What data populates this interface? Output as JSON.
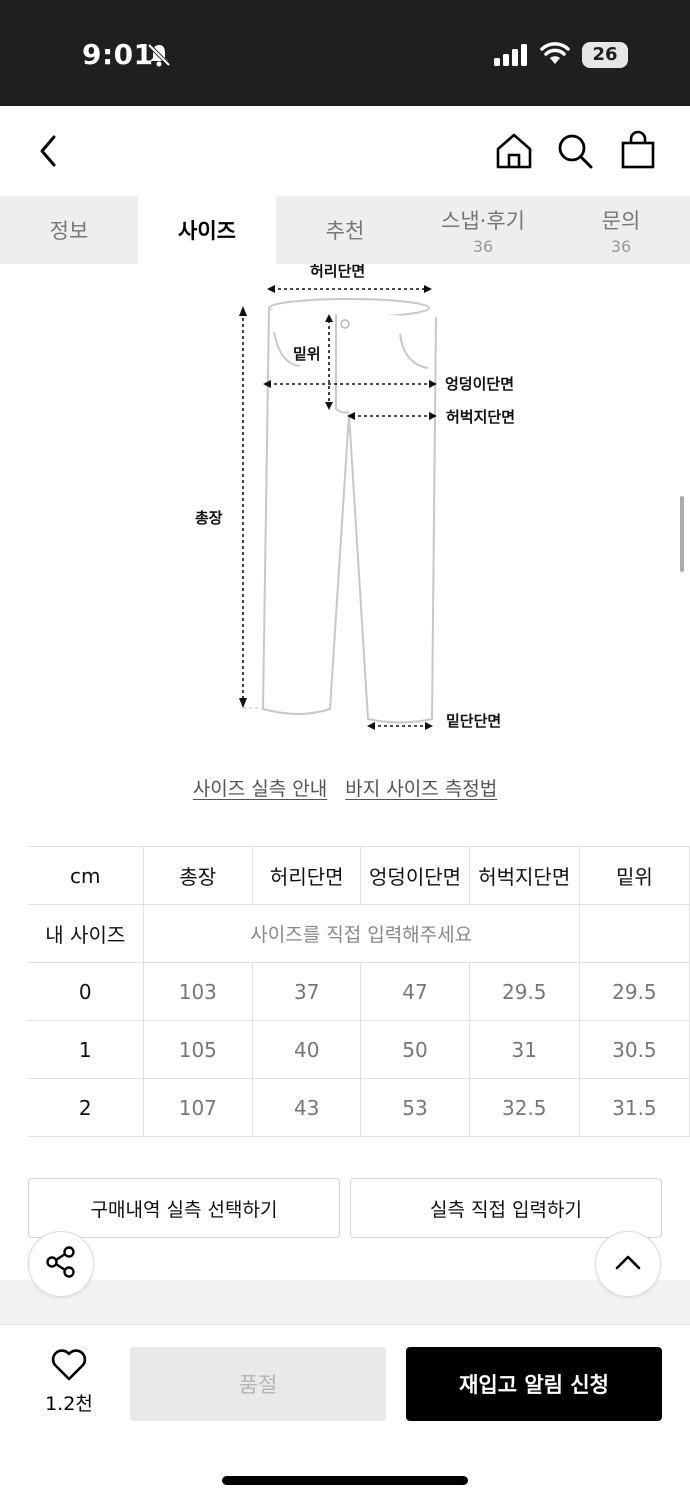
{
  "status": {
    "time": "9:01",
    "battery": "26"
  },
  "tabs": [
    {
      "label": "정보",
      "count": ""
    },
    {
      "label": "사이즈",
      "count": ""
    },
    {
      "label": "추천",
      "count": ""
    },
    {
      "label": "스냅·후기",
      "count": "36"
    },
    {
      "label": "문의",
      "count": "36"
    }
  ],
  "diagram": {
    "labels": {
      "waist": "허리단면",
      "rise": "밑위",
      "hip": "엉덩이단면",
      "thigh": "허벅지단면",
      "length": "총장",
      "hem": "밑단단면"
    }
  },
  "guides": {
    "actual": "사이즈 실측 안내",
    "measure": "바지 사이즈 측정법"
  },
  "table": {
    "unit": "cm",
    "columns": [
      "총장",
      "허리단면",
      "엉덩이단면",
      "허벅지단면",
      "밑위"
    ],
    "my_size_label": "내 사이즈",
    "my_size_hint": "사이즈를 직접 입력해주세요",
    "rows": [
      {
        "size": "0",
        "values": [
          "103",
          "37",
          "47",
          "29.5",
          "29.5"
        ]
      },
      {
        "size": "1",
        "values": [
          "105",
          "40",
          "50",
          "31",
          "30.5"
        ]
      },
      {
        "size": "2",
        "values": [
          "107",
          "43",
          "53",
          "32.5",
          "31.5"
        ]
      }
    ]
  },
  "buttons": {
    "history": "구매내역 실측 선택하기",
    "direct": "실측 직접 입력하기"
  },
  "bottom": {
    "likes": "1.2천",
    "soldout": "품절",
    "restock": "재입고 알림 신청"
  }
}
